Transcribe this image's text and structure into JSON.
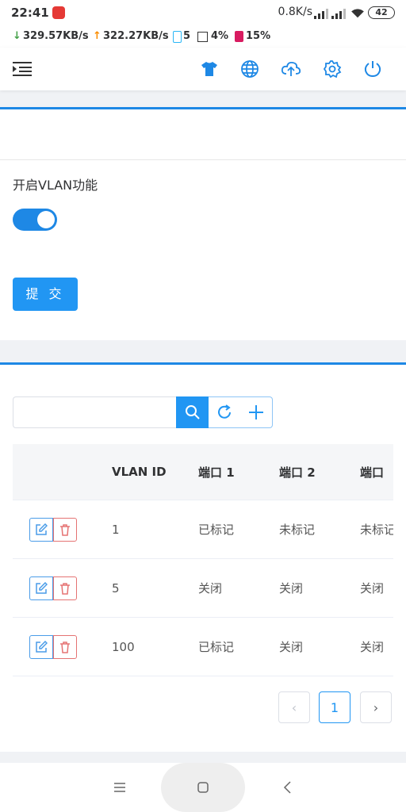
{
  "status": {
    "time": "22:41",
    "speed": "0.8K/s",
    "battery": "42"
  },
  "netbar": {
    "download": "329.57KB/s",
    "upload": "322.27KB/s",
    "devices": "5",
    "cpu": "4%",
    "mem": "15%"
  },
  "accent": "#2196f3",
  "vlan_card": {
    "label": "开启VLAN功能",
    "enabled": true,
    "submit_label": "提 交"
  },
  "table": {
    "columns": [
      "",
      "VLAN ID",
      "端口 1",
      "端口 2",
      "端口"
    ],
    "rows": [
      [
        "1",
        "已标记",
        "未标记",
        "未标记"
      ],
      [
        "5",
        "关闭",
        "关闭",
        "关闭"
      ],
      [
        "100",
        "已标记",
        "关闭",
        "关闭"
      ]
    ]
  },
  "pagination": {
    "current": "1",
    "prev": "‹",
    "next": "›"
  }
}
